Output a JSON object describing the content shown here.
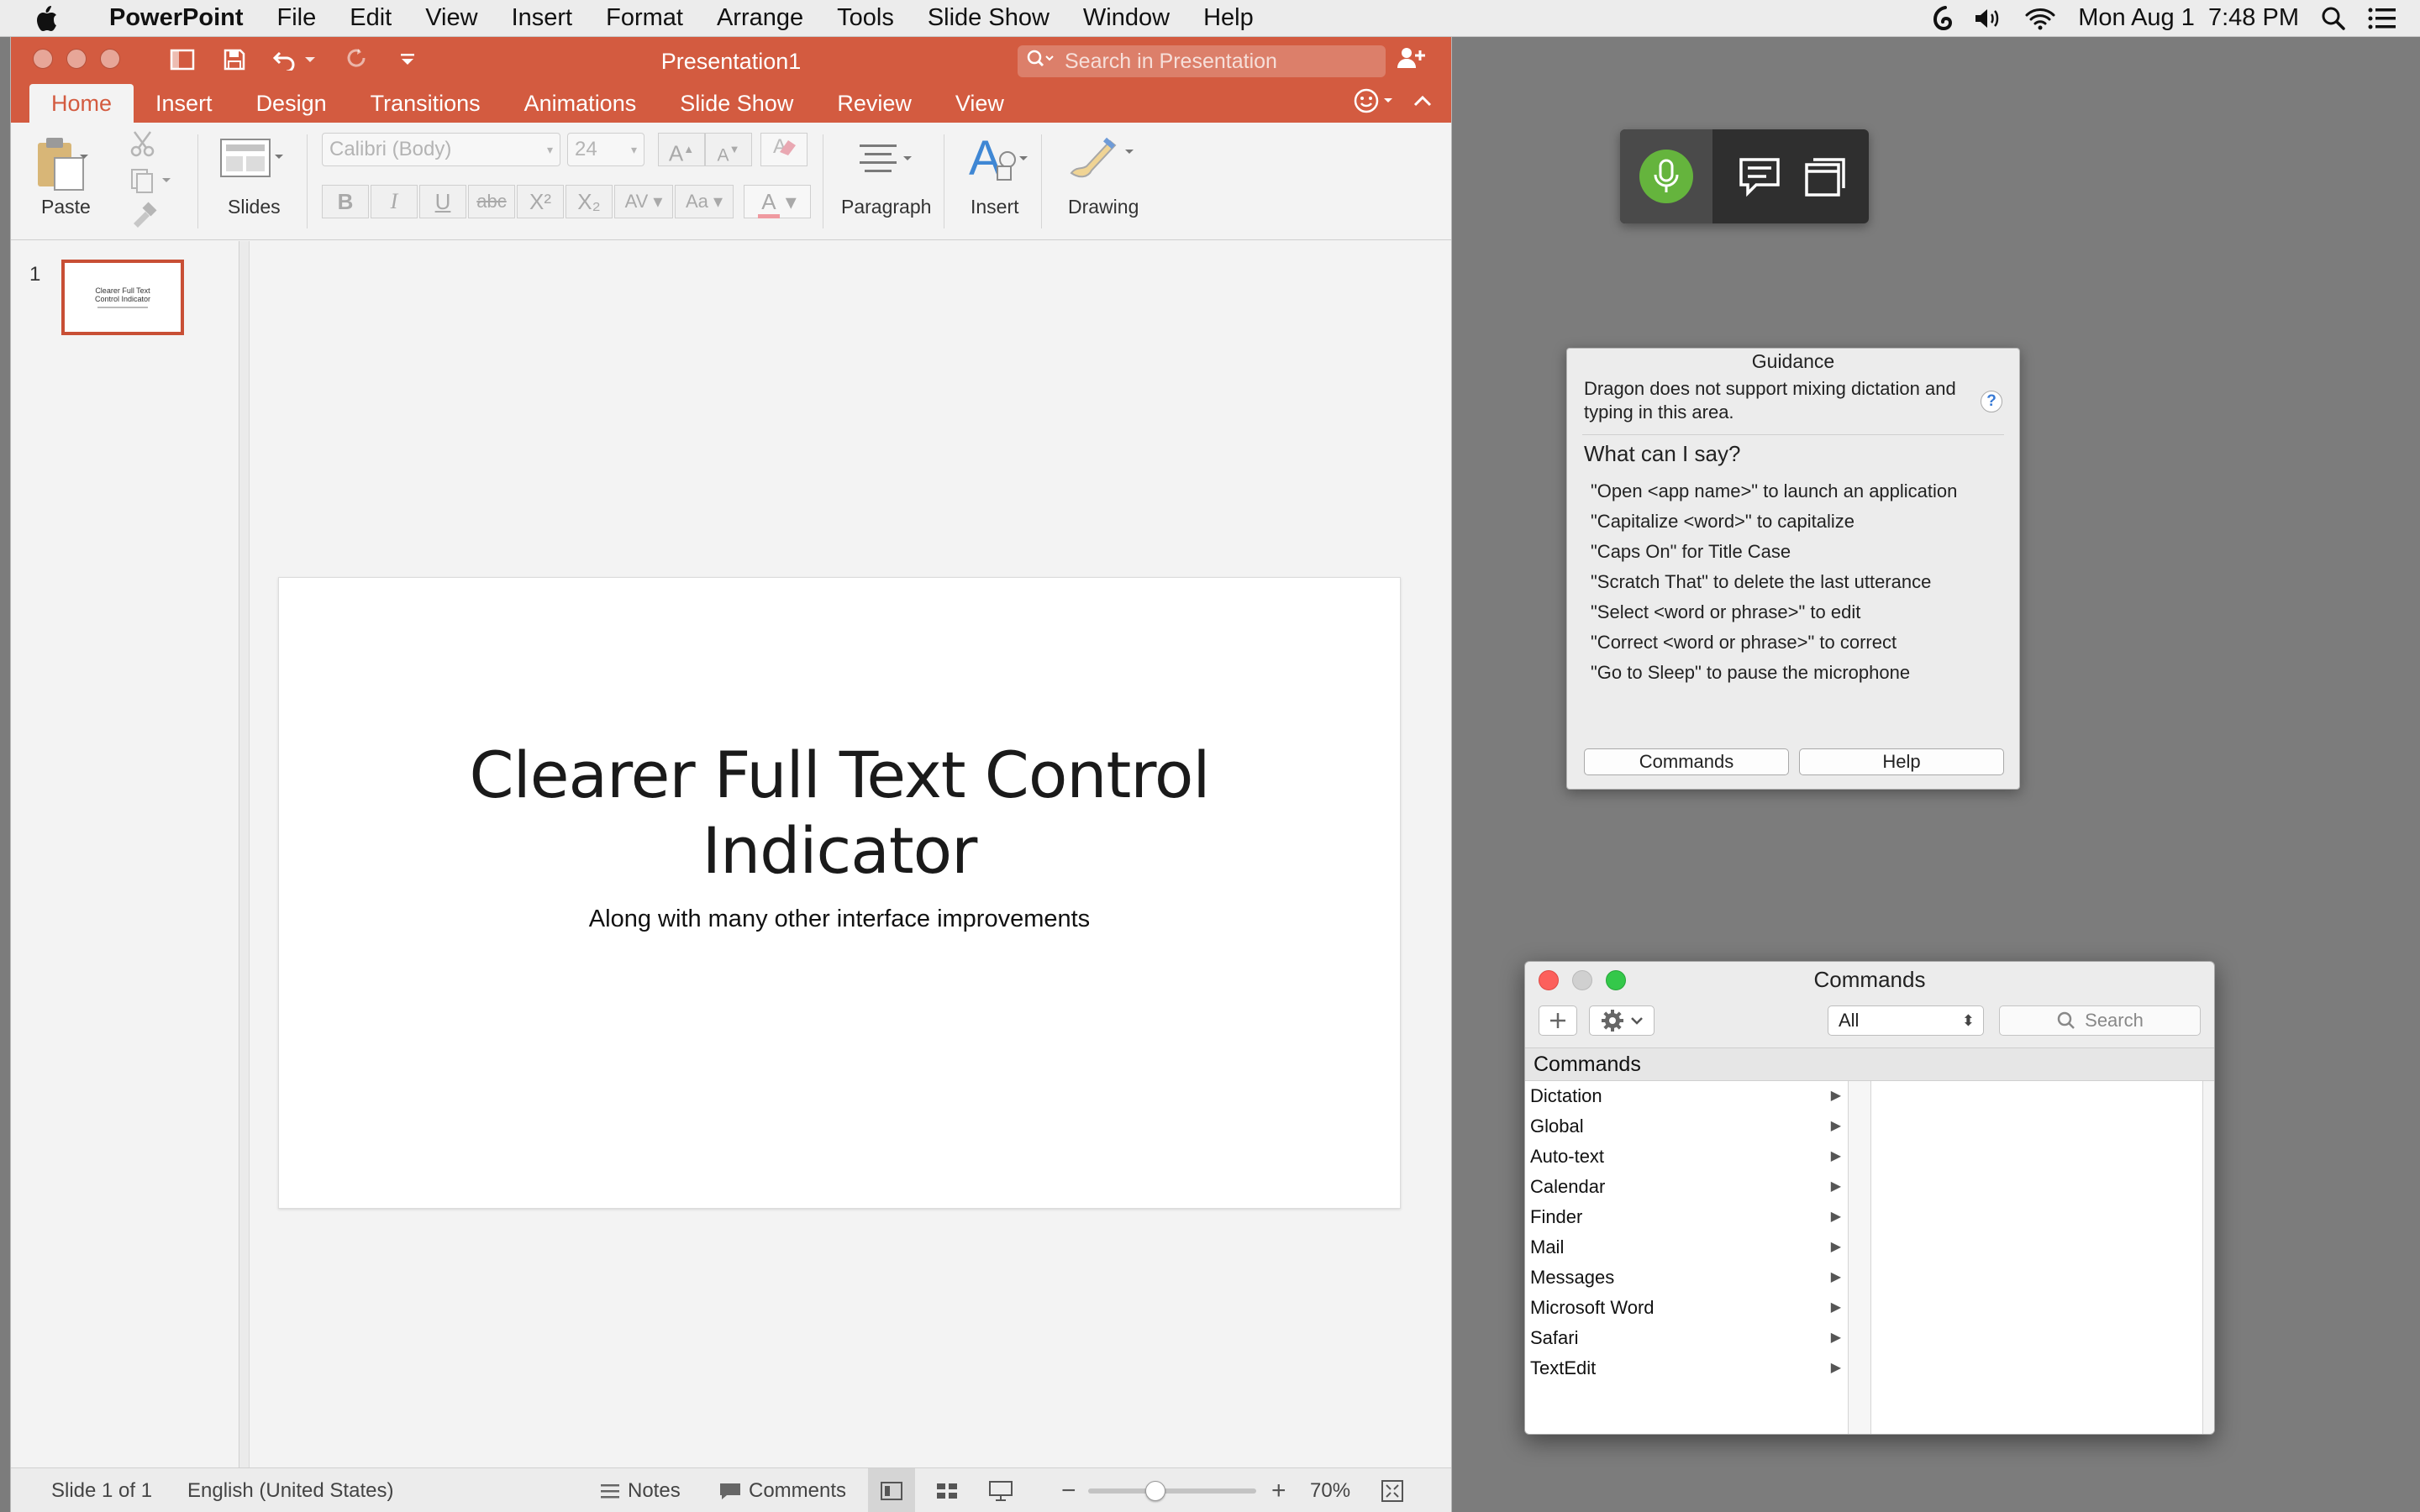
{
  "menubar": {
    "app_name": "PowerPoint",
    "items": [
      "File",
      "Edit",
      "View",
      "Insert",
      "Format",
      "Arrange",
      "Tools",
      "Slide Show",
      "Window",
      "Help"
    ],
    "clock": "Mon Aug 1  7:48 PM"
  },
  "ppt": {
    "document_title": "Presentation1",
    "search_placeholder": "Search in Presentation",
    "tabs": [
      "Home",
      "Insert",
      "Design",
      "Transitions",
      "Animations",
      "Slide Show",
      "Review",
      "View"
    ],
    "active_tab": "Home",
    "ribbon": {
      "paste": "Paste",
      "slides": "Slides",
      "font_name": "Calibri (Body)",
      "font_size": "24",
      "paragraph": "Paragraph",
      "insert": "Insert",
      "drawing": "Drawing",
      "bold": "B",
      "italic": "I",
      "underline": "U",
      "strike": "abc",
      "superscript": "X²",
      "subscript": "X₂",
      "spacing": "AV",
      "case": "Aa",
      "font_color": "A",
      "grow": "A",
      "shrink": "A"
    },
    "thumbnail": {
      "number": "1",
      "title": "Clearer Full Text Control Indicator"
    },
    "slide": {
      "title_line1": "Clearer Full Text Control",
      "title_line2": "Indicator",
      "subtitle": "Along with many other interface improvements"
    },
    "status": {
      "slide_count": "Slide 1 of 1",
      "language": "English (United States)",
      "notes": "Notes",
      "comments": "Comments",
      "zoom": "70%",
      "zoom_fraction": 0.4
    }
  },
  "guidance": {
    "title": "Guidance",
    "note": "Dragon does not support mixing dictation and typing in this area.",
    "heading": "What can I say?",
    "tips": [
      "\"Open <app name>\" to launch an application",
      "\"Capitalize <word>\" to capitalize",
      "\"Caps On\" for Title Case",
      "\"Scratch That\" to delete the last utterance",
      "\"Select <word or phrase>\" to edit",
      "\"Correct <word or phrase>\" to correct",
      "\"Go to Sleep\" to pause the microphone"
    ],
    "commands_button": "Commands",
    "help_button": "Help"
  },
  "commands": {
    "title": "Commands",
    "filter_value": "All",
    "search_placeholder": "Search",
    "column_header": "Commands",
    "items": [
      "Dictation",
      "Global",
      "Auto-text",
      "Calendar",
      "Finder",
      "Mail",
      "Messages",
      "Microsoft Word",
      "Safari",
      "TextEdit"
    ]
  },
  "colors": {
    "accent": "#d35b40",
    "dragon_mic": "#65b43d",
    "close": "#fc605c",
    "minimize": "#d0d0d0",
    "zoom": "#34c84a"
  },
  "icons": [
    "apple-icon",
    "dragon-icon",
    "volume-icon",
    "wifi-icon",
    "spotlight-icon",
    "notification-center-icon",
    "microphone-icon",
    "chat-bubble-icon",
    "window-icon",
    "gear-icon",
    "plus-icon",
    "search-icon"
  ]
}
